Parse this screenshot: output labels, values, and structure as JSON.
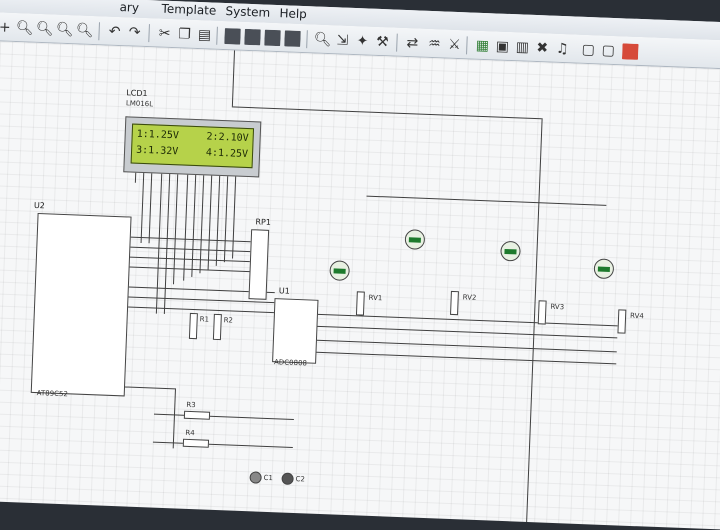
{
  "menu": {
    "items": [
      {
        "id": "library",
        "label": "ary"
      },
      {
        "id": "template",
        "label": "Template"
      },
      {
        "id": "system",
        "label": "System"
      },
      {
        "id": "help",
        "label": "Help"
      }
    ]
  },
  "toolbar": {
    "icons": [
      "add-icon",
      "zoom-in-icon",
      "zoom-out-icon",
      "zoom-all-icon",
      "zoom-area-icon",
      "undo-icon",
      "redo-icon",
      "cut-icon",
      "copy-icon",
      "paste-icon",
      "block-copy-icon",
      "block-move-icon",
      "block-rotate-icon",
      "block-delete-icon",
      "pick-device-icon",
      "make-device-icon",
      "packaging-icon",
      "decompose-icon",
      "wire-autorouter-icon",
      "search-tag-icon",
      "property-tool-icon",
      "new-sheet-icon",
      "remove-sheet-icon",
      "goto-sheet-icon",
      "export-icon",
      "bom-icon",
      "erc-icon",
      "netlist-icon",
      "ares-icon"
    ]
  },
  "schematic": {
    "lcd": {
      "ref": "LCD1",
      "part": "LM016L",
      "line1_left": "1:1.25V",
      "line1_right": "2:2.10V",
      "line2_left": "3:1.32V",
      "line2_right": "4:1.25V"
    },
    "microcontroller": {
      "ref": "U2",
      "part": "AT89C52"
    },
    "resistor_pack": {
      "ref": "RP1"
    },
    "adc": {
      "ref": "U1",
      "part": "ADC0808"
    },
    "resistors": [
      "R1",
      "R2",
      "R3",
      "R4"
    ],
    "potentiometers": [
      "RV1",
      "RV2",
      "RV3",
      "RV4"
    ],
    "voltmeters": [
      "+88.8",
      "+88.8",
      "+88.8",
      "+88.8"
    ],
    "bottom_probes": [
      "C1",
      "C2"
    ]
  }
}
